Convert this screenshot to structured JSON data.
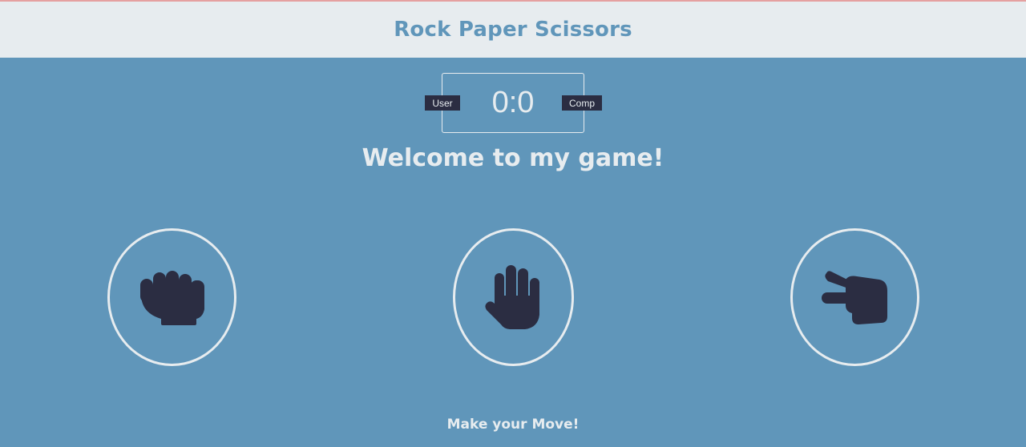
{
  "header": {
    "title": "Rock Paper Scissors"
  },
  "scoreboard": {
    "user_label": "User",
    "comp_label": "Comp",
    "score": "0:0"
  },
  "message": "Welcome to my game!",
  "choices": [
    {
      "name": "rock",
      "icon": "fist-icon"
    },
    {
      "name": "paper",
      "icon": "open-hand-icon"
    },
    {
      "name": "scissors",
      "icon": "two-fingers-icon"
    }
  ],
  "prompt": "Make your Move!",
  "colors": {
    "background": "#6096ba",
    "header_bg": "#e7ecef",
    "accent": "#6096ba",
    "badge_bg": "#2b2d42",
    "icon": "#2b2d42",
    "text": "#e7ecef"
  }
}
